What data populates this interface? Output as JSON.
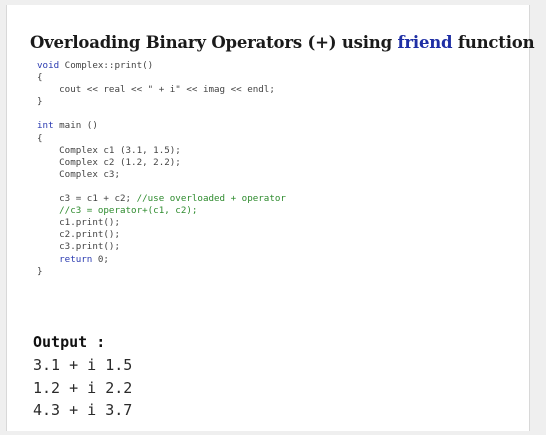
{
  "title": {
    "prefix": "Overloading Binary Operators (+) using ",
    "keyword": "friend",
    "suffix": " function"
  },
  "code": {
    "l0": [
      {
        "t": "void",
        "c": "kw"
      },
      {
        "t": " Complex::print()",
        "c": ""
      }
    ],
    "l1": [
      {
        "t": "{",
        "c": ""
      }
    ],
    "l2": [
      {
        "t": "    cout << real << \" + i\" << imag << endl;",
        "c": ""
      }
    ],
    "l3": [
      {
        "t": "}",
        "c": ""
      }
    ],
    "l4": [
      {
        "t": "",
        "c": ""
      }
    ],
    "l5": [
      {
        "t": "int",
        "c": "kw"
      },
      {
        "t": " main ()",
        "c": ""
      }
    ],
    "l6": [
      {
        "t": "{",
        "c": ""
      }
    ],
    "l7": [
      {
        "t": "    Complex c1 (3.1, 1.5);",
        "c": ""
      }
    ],
    "l8": [
      {
        "t": "    Complex c2 (1.2, 2.2);",
        "c": ""
      }
    ],
    "l9": [
      {
        "t": "    Complex c3;",
        "c": ""
      }
    ],
    "l10": [
      {
        "t": "",
        "c": ""
      }
    ],
    "l11": [
      {
        "t": "    c3 = c1 + c2; ",
        "c": ""
      },
      {
        "t": "//use overloaded + operator",
        "c": "cm"
      }
    ],
    "l12": [
      {
        "t": "    //c3 = operator+(c1, c2);",
        "c": "cm"
      }
    ],
    "l13": [
      {
        "t": "    c1.print();",
        "c": ""
      }
    ],
    "l14": [
      {
        "t": "    c2.print();",
        "c": ""
      }
    ],
    "l15": [
      {
        "t": "    c3.print();",
        "c": ""
      }
    ],
    "l16": [
      {
        "t": "    ",
        "c": ""
      },
      {
        "t": "return",
        "c": "kw"
      },
      {
        "t": " 0;",
        "c": ""
      }
    ],
    "l17": [
      {
        "t": "}",
        "c": ""
      }
    ]
  },
  "output": {
    "heading": "Output :",
    "lines": [
      "3.1 + i 1.5",
      "1.2 + i 2.2",
      "4.3 + i 3.7"
    ]
  },
  "colors": {
    "keyword": "#2a3ab0",
    "comment": "#2e8b2e",
    "title_keyword": "#1f2fa5"
  }
}
